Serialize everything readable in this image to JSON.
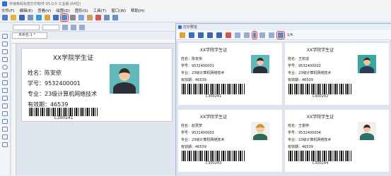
{
  "window": {
    "title": "中琅条码标签打印软件 V5.0.0 工业版 (64位)"
  },
  "menu": [
    "文件(F)",
    "编辑(E)",
    "查看(V)",
    "绘图(D)",
    "图形(S)",
    "工具(T)",
    "窗口(W)",
    "帮助(H)"
  ],
  "document": {
    "tab": "未命名-1 *"
  },
  "preview": {
    "title": "打印预览",
    "page_indicator": "1/4"
  },
  "card_template": {
    "title": "XX学院学生证",
    "name_label": "姓名：陈安依",
    "id_label": "学号：9532400001",
    "major_label": "专业：23级计算机网络技术",
    "validity_label": "有效期：46539",
    "barcode": "C300241"
  },
  "cards": [
    {
      "title": "XX学院学生证",
      "name": "姓名：陈安依",
      "id": "学号：9532400001",
      "major": "专业：23级计算机网络技术",
      "validity": "有效期：46539",
      "barcode": "C300241",
      "avatar_color": "#5fb9bb"
    },
    {
      "title": "XX学院学生证",
      "name": "姓名：王钦迪",
      "id": "学号：9532400002",
      "major": "专业：23级计算机网络技术",
      "validity": "有效期：46539",
      "barcode": "C300242",
      "avatar_color": "#3aa79f"
    },
    {
      "title": "XX学院学生证",
      "name": "姓名：赵慧梦",
      "id": "学号：9532400003",
      "major": "专业：23级计算机网络技术",
      "validity": "有效期：46539",
      "barcode": "C300243",
      "avatar_color": "#f0f0f0"
    },
    {
      "title": "XX学院学生证",
      "name": "姓名：王景婷",
      "id": "学号：9532400004",
      "major": "专业：23级计算机网络技术",
      "validity": "有效期：46539",
      "barcode": "C300244",
      "avatar_color": "#f0f0f0"
    }
  ]
}
